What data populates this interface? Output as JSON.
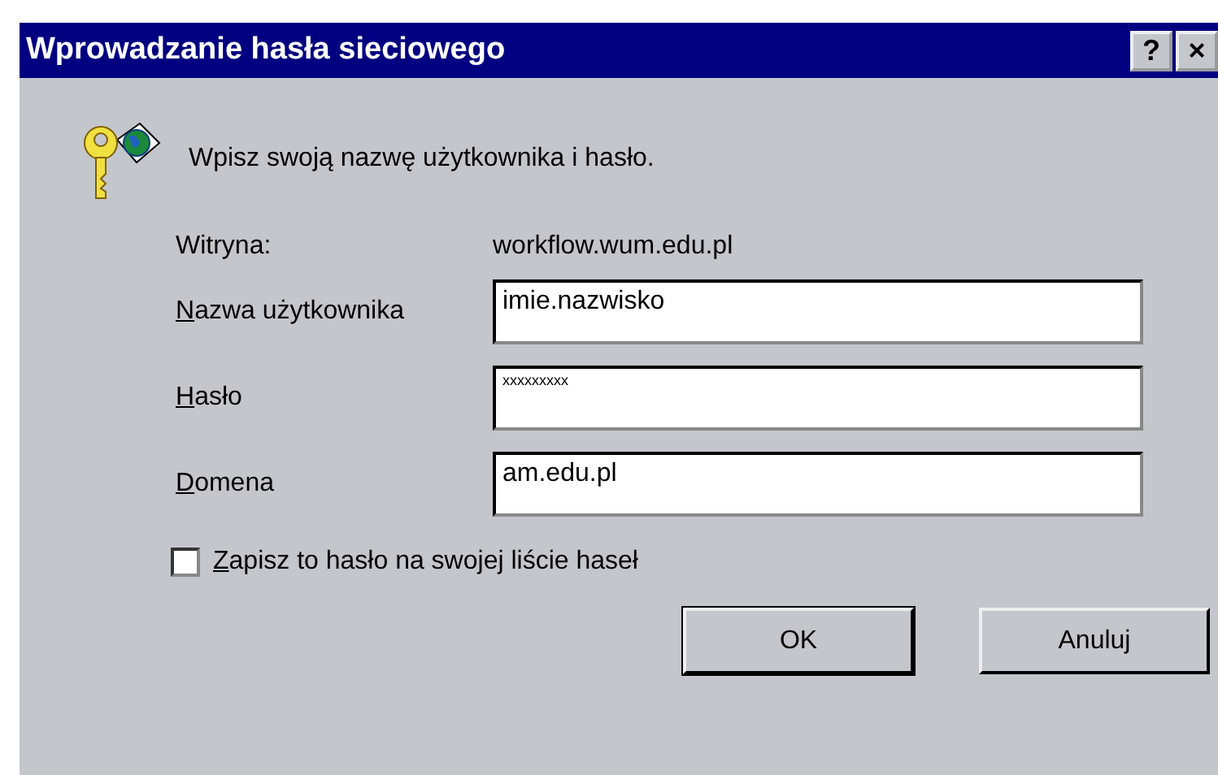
{
  "window": {
    "title": "Wprowadzanie hasła sieciowego",
    "title_buttons": [
      "?",
      "×"
    ]
  },
  "message": "Wpisz swoją nazwę użytkownika i hasło.",
  "site": {
    "label": "Witryna:",
    "value": "workflow.wum.edu.pl"
  },
  "fields": [
    {
      "label": "Nazwa użytkownika",
      "value": "imie.nazwisko"
    },
    {
      "label": "Hasło",
      "value": "xxxxxxxxx"
    },
    {
      "label": "Domena",
      "value": "am.edu.pl"
    }
  ],
  "save_password": {
    "label": "Zapisz to hasło na swojej liście haseł",
    "checked": false
  },
  "buttons": [
    "OK",
    "Anuluj"
  ]
}
